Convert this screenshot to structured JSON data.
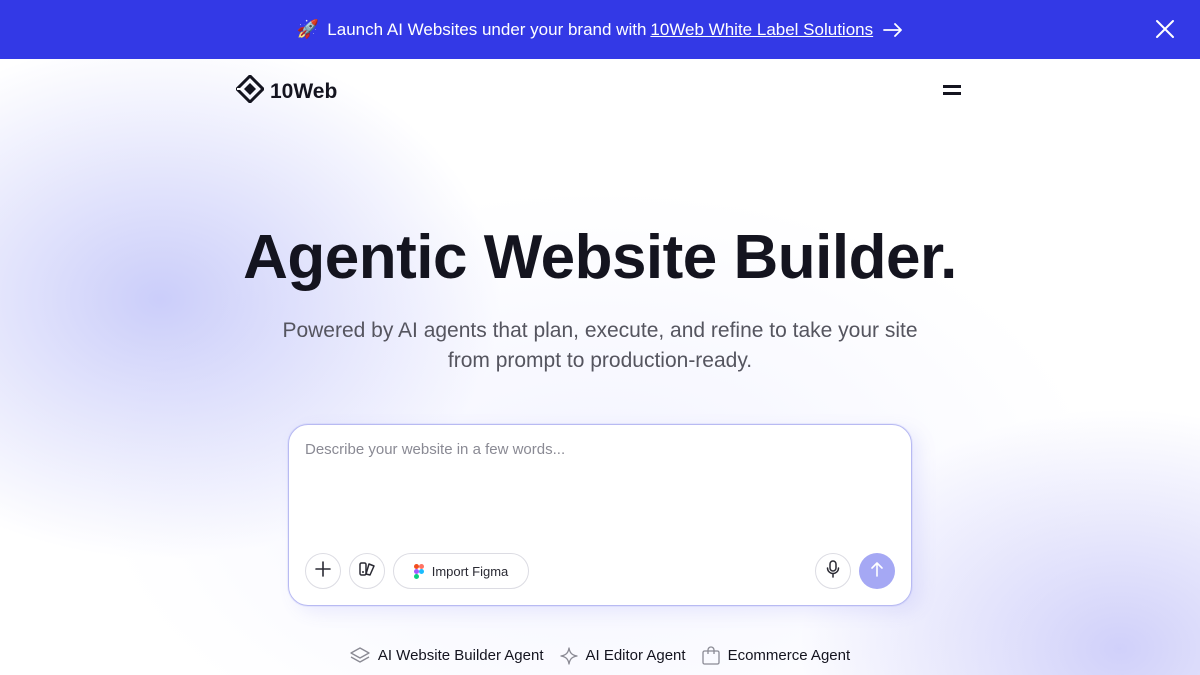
{
  "banner": {
    "rocket_icon": "🚀",
    "text": "Launch AI Websites under your brand with",
    "link_text": "10Web White Label Solutions"
  },
  "nav": {
    "logo_text": "10Web"
  },
  "hero": {
    "title": "Agentic Website Builder.",
    "subtitle": "Powered by AI agents that plan, execute, and refine to take your site from prompt to production-ready."
  },
  "prompt": {
    "placeholder": "Describe your website in a few words...",
    "figma_label": "Import Figma"
  },
  "agents": [
    {
      "label": "AI Website Builder Agent",
      "icon": "layers-icon"
    },
    {
      "label": "AI Editor Agent",
      "icon": "sparkle-icon"
    },
    {
      "label": "Ecommerce Agent",
      "icon": "shopping-bag-icon"
    }
  ],
  "colors": {
    "banner": "#3339e6",
    "send_button": "#a5a8f4",
    "text": "#14141f"
  }
}
